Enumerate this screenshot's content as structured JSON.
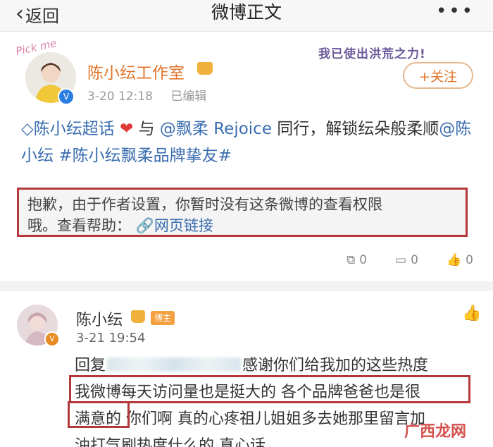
{
  "nav": {
    "back_icon": "chevron-left-icon",
    "back_label": "返回",
    "title": "微博正文",
    "more_label": "•••"
  },
  "post": {
    "author": "陈小纭工作室",
    "time": "3-20 12:18",
    "edited": "已编辑",
    "slogan": "我已使出洪荒之力!",
    "avatar_text": "Pick me",
    "follow_label": "+关注",
    "body": {
      "topic": "陈小纭超话",
      "heart": "❤",
      "with": "与",
      "mention1": "@飘柔 Rejoice",
      "text1": "同行，解锁纭朵般柔顺",
      "mention2": "@陈小纭",
      "hashtag": "#陈小纭飘柔品牌挚友#"
    },
    "notice_line1": "抱歉，由于作者设置，你暂时没有这条微博的查看权限",
    "notice_line2_prefix": "哦。查看帮助：",
    "notice_link": "网页链接",
    "actions": {
      "repost_count": "0",
      "comment_count": "0",
      "like_count": "0"
    }
  },
  "comment": {
    "author": "陈小纭",
    "badge": "博主",
    "time": "3-21 19:54",
    "reply_prefix": "回复",
    "line1": "感谢你们给我加的这些热度",
    "line2": "我微博每天访问量也是挺大的 各个品牌爸爸也是很",
    "line3a": "满意的",
    "line3b": " 你们啊 真的心疼祖儿姐姐多去她那里留言加",
    "line4": "油打气刷热度什么的 真心话"
  },
  "watermark": "广西龙网",
  "colors": {
    "accent_orange": "#e0742b",
    "link_blue": "#3a6db0",
    "highlight_red": "#b3373b"
  }
}
